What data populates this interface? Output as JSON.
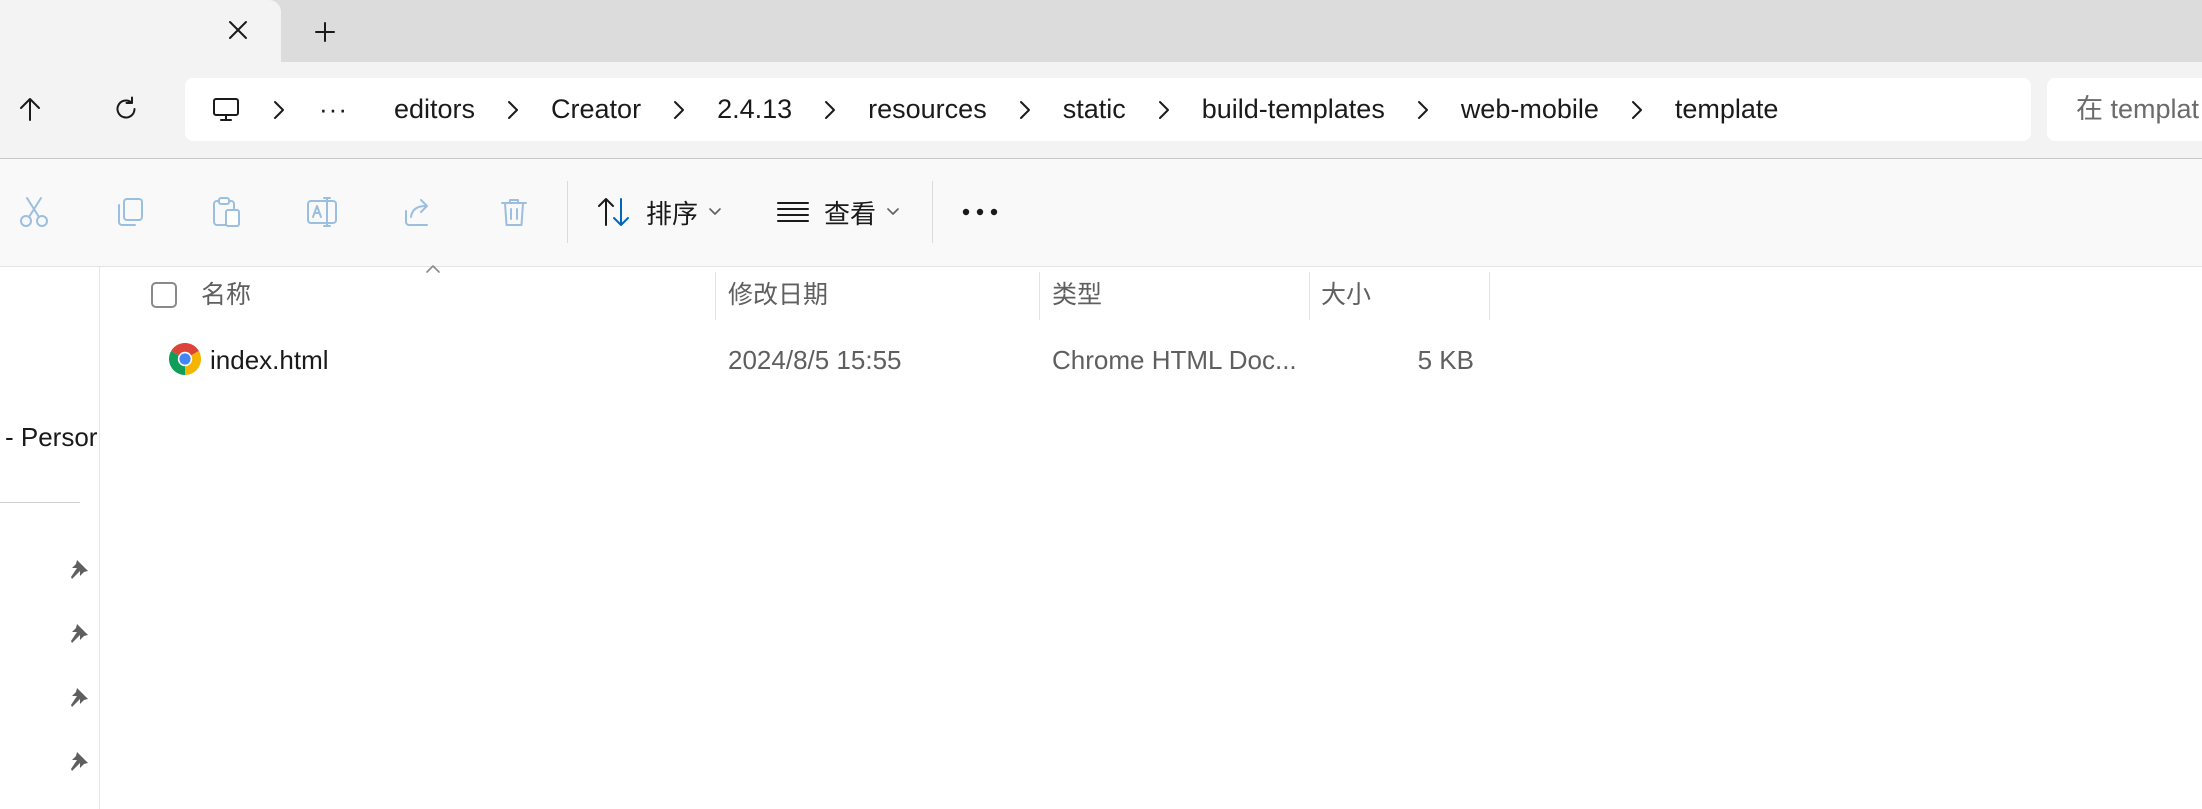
{
  "tab": {
    "close_icon": "close-icon",
    "new_tab_icon": "plus-icon"
  },
  "nav": {
    "up_icon": "arrow-up-icon",
    "refresh_icon": "refresh-icon"
  },
  "breadcrumb": {
    "root_icon": "computer-icon",
    "overflow": "···",
    "items": [
      "editors",
      "Creator",
      "2.4.13",
      "resources",
      "static",
      "build-templates",
      "web-mobile",
      "template"
    ]
  },
  "search": {
    "placeholder": "在 templat"
  },
  "toolbar": {
    "cut_icon": "cut-icon",
    "copy_icon": "copy-icon",
    "paste_icon": "paste-icon",
    "rename_icon": "rename-icon",
    "share_icon": "share-icon",
    "delete_icon": "delete-icon",
    "sort_label": "排序",
    "view_label": "查看",
    "more_label": "···"
  },
  "sidebar": {
    "item_label": "- Persor",
    "pins": [
      "pin-icon",
      "pin-icon",
      "pin-icon",
      "pin-icon"
    ]
  },
  "table": {
    "headers": {
      "name": "名称",
      "modified": "修改日期",
      "type": "类型",
      "size": "大小"
    },
    "rows": [
      {
        "name": "index.html",
        "modified": "2024/8/5 15:55",
        "type": "Chrome HTML Doc...",
        "size": "5 KB",
        "icon": "chrome-icon"
      }
    ]
  },
  "colors": {
    "accent": "#0067c0",
    "disabled_icon": "#9bbfe0",
    "tabstrip": "#dcdcdc"
  }
}
